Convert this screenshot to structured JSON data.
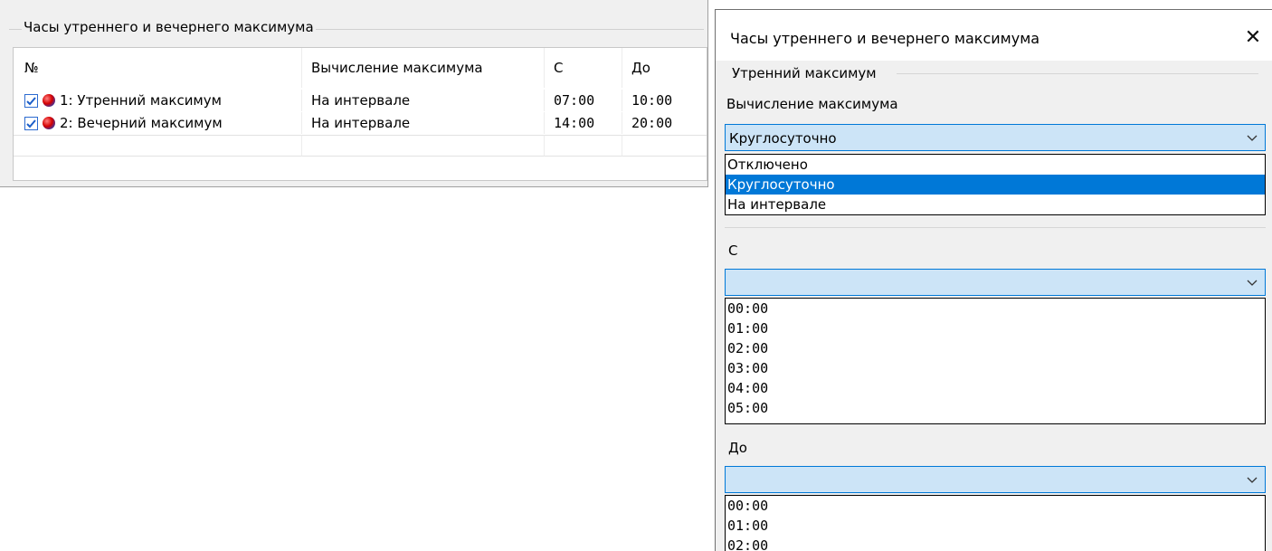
{
  "left_group": {
    "title": "Часы утреннего и вечернего максимума",
    "columns": [
      "№",
      "Вычисление максимума",
      "С",
      "До"
    ],
    "rows": [
      {
        "checked": true,
        "name": "1: Утренний максимум",
        "calc": "На интервале",
        "from": "07:00",
        "to": "10:00"
      },
      {
        "checked": true,
        "name": "2: Вечерний максимум",
        "calc": "На интервале",
        "from": "14:00",
        "to": "20:00"
      }
    ]
  },
  "dialog": {
    "title": "Часы утреннего и вечернего максимума",
    "close_glyph": "✕",
    "group_label": "Утренний максимум",
    "calc": {
      "label": "Вычисление максимума",
      "value": "Круглосуточно",
      "options": [
        "Отключено",
        "Круглосуточно",
        "На интервале"
      ],
      "selected_index": 1
    },
    "from": {
      "label": "С",
      "value": "",
      "options": [
        "00:00",
        "01:00",
        "02:00",
        "03:00",
        "04:00",
        "05:00"
      ]
    },
    "to": {
      "label": "До",
      "value": "",
      "options": [
        "00:00",
        "01:00",
        "02:00"
      ]
    }
  },
  "colors": {
    "accent": "#0078d7",
    "combo_bg": "#cce4f7",
    "panel_bg": "#f0f0f0"
  }
}
